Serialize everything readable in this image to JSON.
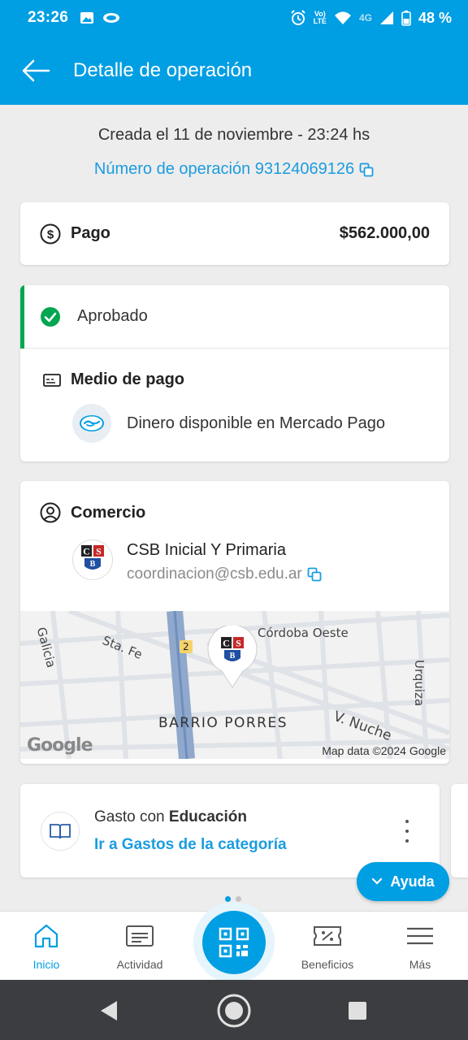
{
  "status_bar": {
    "time": "23:26",
    "net_label_top": "Vo)",
    "net_label_bottom": "LTE",
    "network": "4G",
    "battery": "48 %"
  },
  "header": {
    "title": "Detalle de operación",
    "back_icon": "arrow-left-icon"
  },
  "operation": {
    "created": "Creada el 11 de noviembre - 23:24 hs",
    "number_text": "Número de operación 93124069126"
  },
  "payment": {
    "label": "Pago",
    "amount": "$562.000,00",
    "icon": "dollar-circle-icon"
  },
  "status": {
    "label": "Aprobado",
    "color": "#00a650",
    "payment_method_title": "Medio de pago",
    "payment_method_text": "Dinero disponible en Mercado Pago"
  },
  "merchant": {
    "title": "Comercio",
    "name": "CSB Inicial Y Primaria",
    "email": "coordinacion@csb.edu.ar",
    "map": {
      "streets": [
        "Córdoba Oeste",
        "Sta. Fe",
        "Galicia",
        "Urquiza",
        "V. Nuche"
      ],
      "neighborhood": "BARRIO PORRES",
      "route": "2",
      "google": "Google",
      "attribution": "Map data ©2024 Google"
    }
  },
  "category": {
    "prefix": "Gasto con ",
    "name": "Educación",
    "link": "Ir a Gastos de la categoría"
  },
  "help_button": "Ayuda",
  "bottom_nav": {
    "items": [
      {
        "label": "Inicio",
        "icon": "home-icon"
      },
      {
        "label": "Actividad",
        "icon": "activity-icon"
      },
      {
        "label": "Beneficios",
        "icon": "discount-ticket-icon"
      },
      {
        "label": "Más",
        "icon": "menu-icon"
      }
    ],
    "active": "Inicio"
  },
  "colors": {
    "brand_blue": "#009ee3",
    "link_blue": "#1b9ce0",
    "approved_green": "#00a650"
  }
}
